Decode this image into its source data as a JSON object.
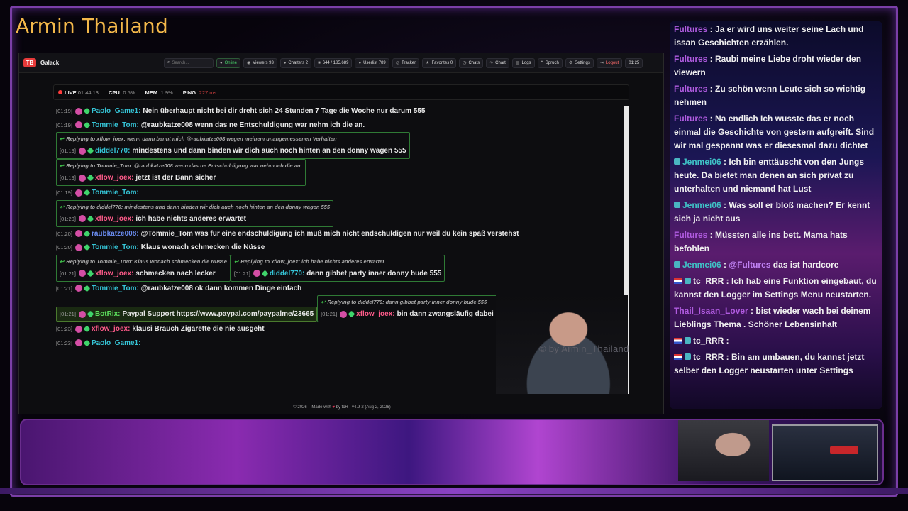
{
  "overlay": {
    "streamer_title": "Armin Thailand",
    "watermark": "© by Armin_Thailand"
  },
  "app": {
    "brand": "Galack",
    "logo": "TB",
    "toolbar": {
      "search_placeholder": "Search...",
      "online": "Online",
      "viewers": "Viewers 93",
      "chatters": "Chatters 2",
      "messages": "644 / 185.689",
      "userlist": "Userlist 789",
      "tracker": "Tracker",
      "favorites": "Favorites 0",
      "chats": "Chats",
      "chart": "Chart",
      "logs": "Logs",
      "spruch": "Spruch",
      "settings": "Settings",
      "logout": "Logout",
      "time": "01:25"
    },
    "status": {
      "live": "LIVE",
      "uptime": "01:44:13",
      "cpu_label": "CPU:",
      "cpu": "0.5%",
      "mem_label": "MEM:",
      "mem": "1.9%",
      "ping_label": "PING:",
      "ping": "227 ms"
    },
    "footer": {
      "text": "© 2026 – Made with",
      "by": "by tcR · v4.9-2 (Aug 2, 2026)"
    }
  },
  "chat": [
    {
      "ts": "[01:19]",
      "user": "Paolo_Game1:",
      "text": "Nein überhaupt nicht bei dir dreht sich 24 Stunden 7 Tage die Woche nur darum 555"
    },
    {
      "ts": "[01:19]",
      "user": "Tommie_Tom:",
      "text": "@raubkatze008 wenn das ne Entschuldigung war nehm ich die an."
    },
    {
      "reply": "Replying to xflow_joex: wenn dann bannt mich @raubkatze008 wegen meinem unangemessenen Verhalten",
      "ts": "[01:19]",
      "user": "diddel770:",
      "text": "mindestens und dann binden wir dich auch noch hinten an den donny wagen 555"
    },
    {
      "reply": "Replying to Tommie_Tom: @raubkatze008 wenn das ne Entschuldigung war nehm ich die an.",
      "ts": "[01:19]",
      "user": "xflow_joex:",
      "text": "jetzt ist der Bann sicher"
    },
    {
      "ts": "[01:19]",
      "user": "Tommie_Tom:",
      "text": ""
    },
    {
      "reply": "Replying to diddel770: mindestens und dann binden wir dich auch noch hinten an den donny wagen 555",
      "ts": "[01:20]",
      "user": "xflow_joex:",
      "text": "ich habe nichts anderes erwartet"
    },
    {
      "ts": "[01:20]",
      "user": "raubkatze008:",
      "text": "@Tommie_Tom was für eine endschuldigung ich muß mich nicht endschuldigen nur weil du kein spaß verstehst"
    },
    {
      "ts": "[01:20]",
      "user": "Tommie_Tom:",
      "text": "Klaus wonach schmecken die Nüsse"
    },
    {
      "reply": "Replying to Tommie_Tom: Klaus wonach schmecken die Nüsse",
      "ts": "[01:21]",
      "user": "xflow_joex:",
      "text": "schmecken nach lecker"
    },
    {
      "reply": "Replying to xflow_joex: ich habe nichts anderes erwartet",
      "ts": "[01:21]",
      "user": "diddel770:",
      "text": "dann gibbet party inner donny bude 555"
    },
    {
      "ts": "[01:21]",
      "user": "Tommie_Tom:",
      "text": "@raubkatze008 ok dann kommen Dinge einfach"
    },
    {
      "ts": "[01:21]",
      "user": "BotRix:",
      "text": "Paypal Support https://www.paypal.com/paypalme/23665",
      "bot": true
    },
    {
      "reply": "Replying to diddel770: dann gibbet party inner donny bude 555",
      "ts": "[01:21]",
      "user": "xflow_joex:",
      "text": "bin dann zwangsläufig dabei"
    },
    {
      "ts": "[01:23]",
      "user": "xflow_joex:",
      "text": "klausi Brauch Zigarette die nie ausgeht"
    },
    {
      "ts": "[01:23]",
      "user": "Paolo_Game1:",
      "text": ""
    }
  ],
  "side_chat": [
    {
      "user": "Fultures",
      "text": "Ja er wird uns weiter seine Lach und issan Geschichten erzählen."
    },
    {
      "user": "Fultures",
      "text": "Raubi meine Liebe droht wieder den viewern"
    },
    {
      "user": "Fultures",
      "text": "Zu schön wenn Leute sich so wichtig nehmen"
    },
    {
      "user": "Fultures",
      "text": "Na endlich Ich wusste das er noch einmal die Geschichte von gestern aufgreift. Sind wir mal gespannt was er diesesmal dazu dichtet"
    },
    {
      "user": "Jenmei06",
      "text": "Ich bin enttäuscht von den Jungs heute. Da bietet man denen an sich privat zu unterhalten und niemand hat Lust"
    },
    {
      "user": "Jenmei06",
      "text": "Was soll er bloß machen? Er kennt sich ja nicht aus"
    },
    {
      "user": "Fultures",
      "text": "Müssten alle ins bett. Mama hats befohlen"
    },
    {
      "user": "Jenmei06",
      "mention": "@Fultures",
      "text": "das ist hardcore"
    },
    {
      "user": "tc_RRR",
      "text": "Ich hab eine Funktion eingebaut, du kannst den Logger im Settings Menu neustarten."
    },
    {
      "user": "Thail_Isaan_Lover",
      "text": "bist wieder wach bei deinem Lieblings Thema . Schöner Lebensinhalt"
    },
    {
      "user": "tc_RRR",
      "text": ""
    },
    {
      "user": "tc_RRR",
      "text": "Bin am umbauen, du kannst jetzt selber den Logger neustarten unter Settings"
    }
  ]
}
